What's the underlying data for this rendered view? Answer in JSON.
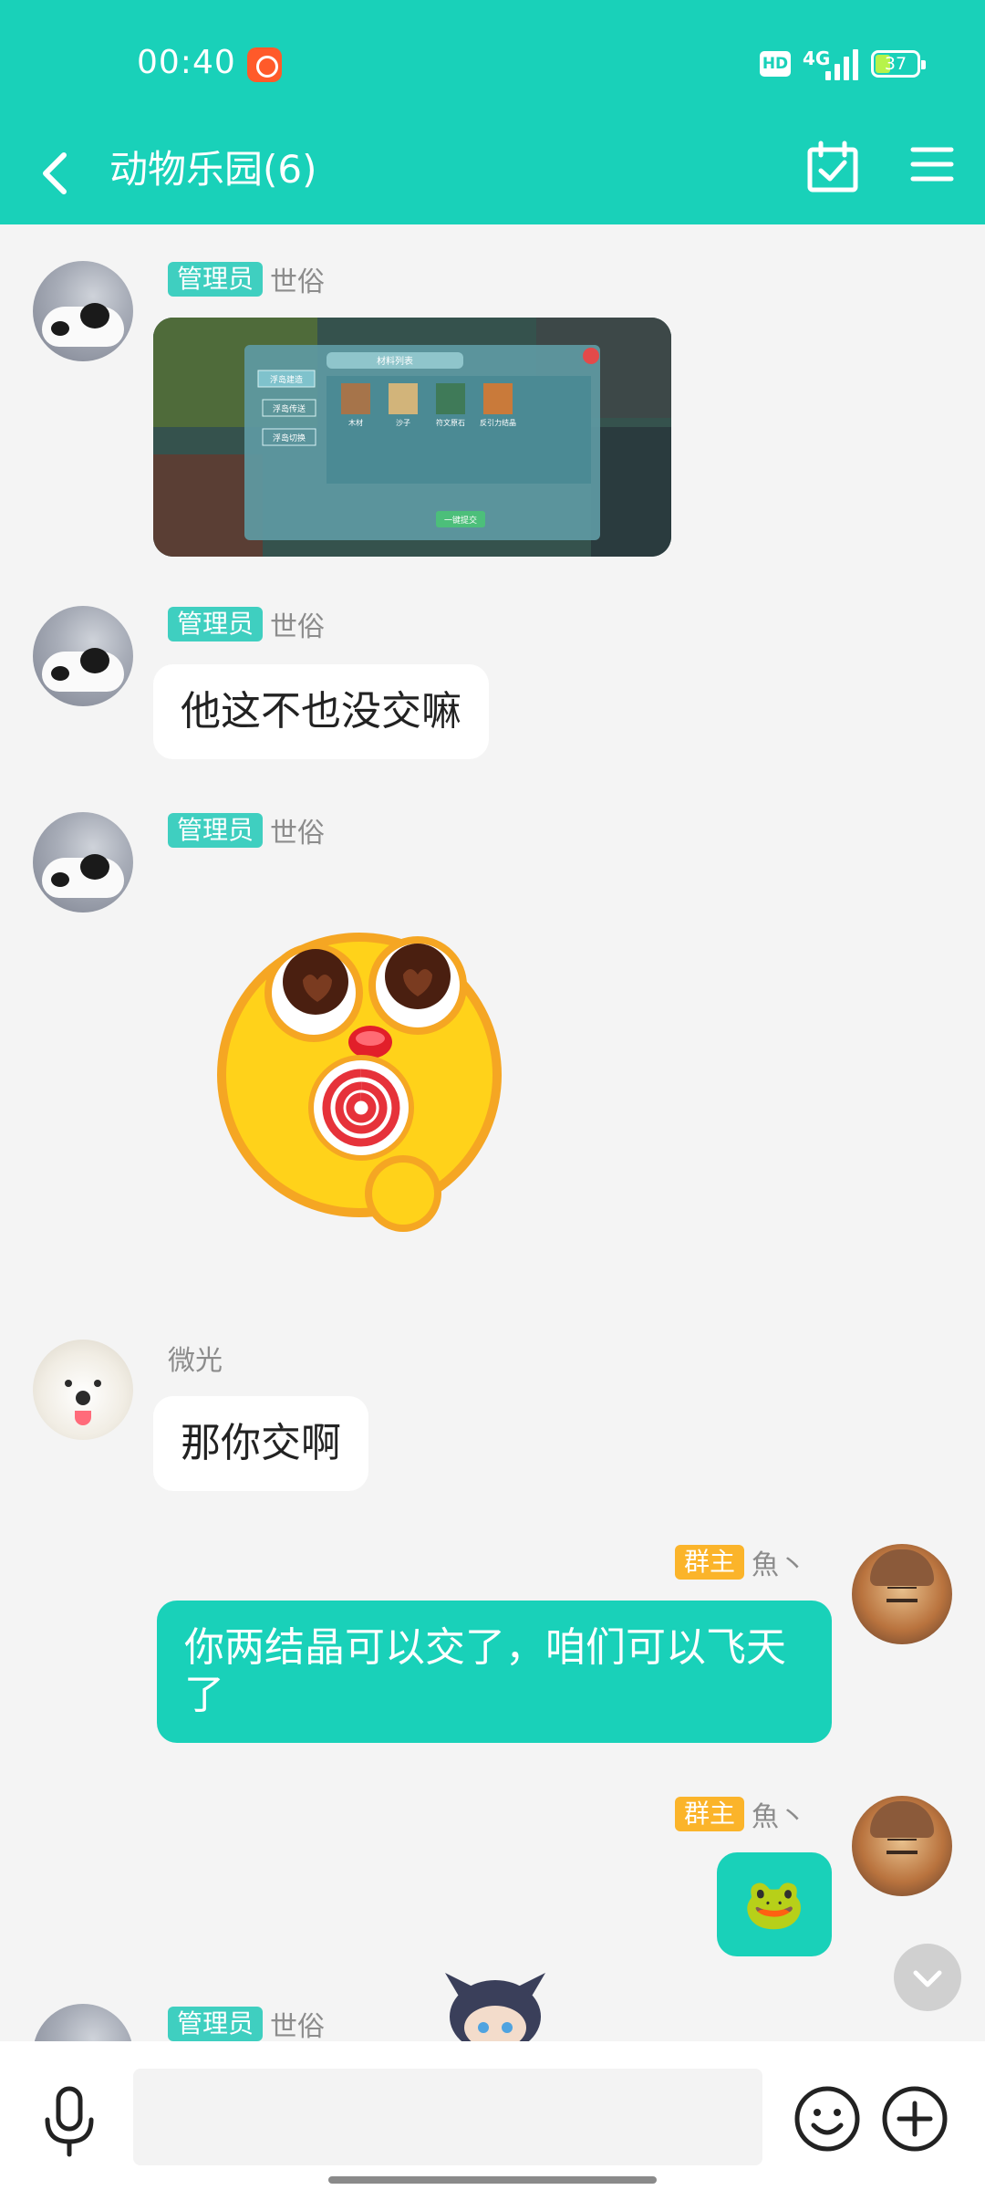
{
  "status_bar": {
    "time": "00:40",
    "hd": "HD",
    "network": "4G",
    "battery": "37",
    "battery_percent": 37
  },
  "header": {
    "title": "动物乐园(6)",
    "back_icon": "back-arrow-icon",
    "calendar_icon": "calendar-check-icon",
    "menu_icon": "menu-icon"
  },
  "messages": [
    {
      "sender": "世俗",
      "badge": "管理员",
      "type": "image",
      "image": {
        "panel_title": "材料列表",
        "tabs": [
          "浮岛建造",
          "浮岛传送",
          "浮岛切换"
        ],
        "items": [
          "木材",
          "沙子",
          "符文原石",
          "反引力结晶"
        ],
        "button": "一键提交"
      }
    },
    {
      "sender": "世俗",
      "badge": "管理员",
      "type": "text",
      "text": "他这不也没交嘛"
    },
    {
      "sender": "世俗",
      "badge": "管理员",
      "type": "sticker",
      "sticker": "lollipop-emoji"
    },
    {
      "sender": "微光",
      "badge": "",
      "type": "text",
      "text": "那你交啊"
    },
    {
      "sender": "魚丶",
      "badge": "群主",
      "type": "text",
      "self": true,
      "text": "你两结晶可以交了，咱们可以飞天了"
    },
    {
      "sender": "魚丶",
      "badge": "群主",
      "type": "emoji",
      "self": true,
      "emoji": "🐸"
    },
    {
      "sender": "世俗",
      "badge": "管理员",
      "type": "partial"
    }
  ],
  "input": {
    "placeholder": "",
    "mic_icon": "microphone-icon",
    "emoji_icon": "smile-icon",
    "plus_icon": "plus-icon"
  },
  "colors": {
    "accent": "#19d1b9",
    "admin_badge": "#3fcfc0",
    "owner_badge": "#fbb42a"
  }
}
